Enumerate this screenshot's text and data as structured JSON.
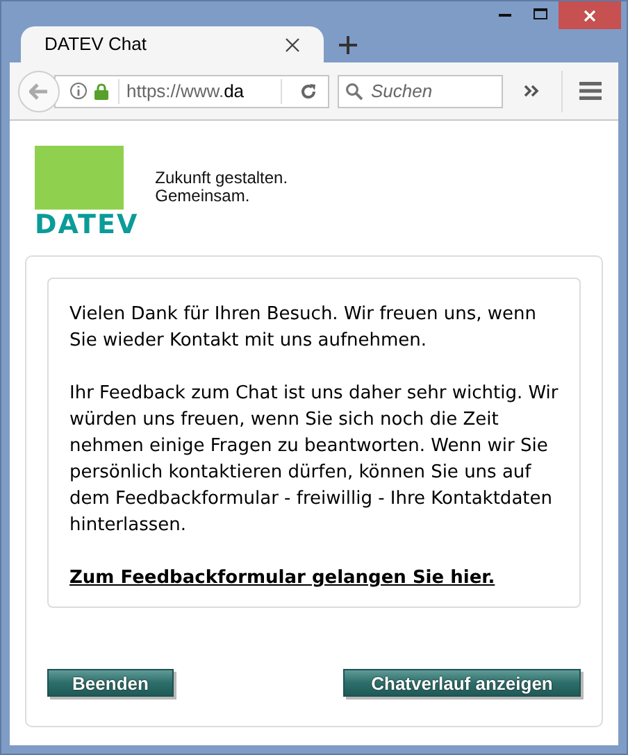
{
  "tab": {
    "title": "DATEV Chat"
  },
  "address_bar": {
    "prefix": "https://www.",
    "host": "da"
  },
  "search": {
    "placeholder": "Suchen"
  },
  "logo": {
    "wordmark": "DATEV",
    "tagline": [
      "Zukunft gestalten.",
      "Gemeinsam."
    ]
  },
  "message": {
    "paragraphs": [
      "Vielen Dank für Ihren Besuch. Wir freuen uns, wenn Sie wieder Kontakt mit uns aufnehmen.",
      "Ihr Feedback zum Chat ist uns daher sehr wichtig. Wir würden uns freuen, wenn Sie sich noch die Zeit nehmen einige Fragen zu beantworten. Wenn wir Sie persönlich kontaktieren dürfen, können Sie uns auf dem Feedbackformular - freiwillig - Ihre Kontaktdaten hinterlassen."
    ],
    "link": "Zum Feedbackformular gelangen Sie hier."
  },
  "buttons": [
    "Beenden",
    "Chatverlauf anzeigen"
  ]
}
